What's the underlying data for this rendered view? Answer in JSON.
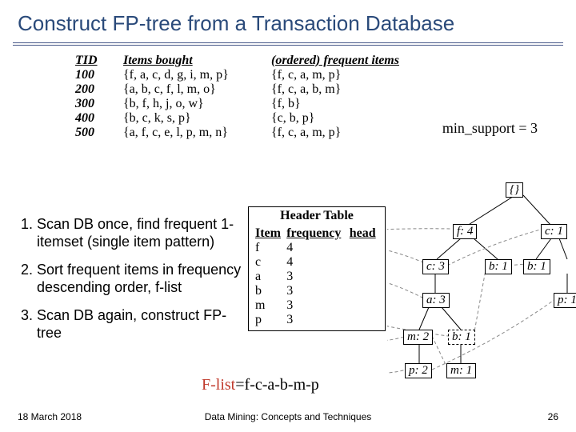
{
  "title": "Construct FP-tree from a Transaction Database",
  "table": {
    "hdr_tid": "TID",
    "hdr_items": "Items bought",
    "hdr_freq": "(ordered) frequent items",
    "rows": [
      {
        "tid": "100",
        "items": "{f, a, c, d, g, i, m, p}",
        "freq": "{f, c, a, m, p}"
      },
      {
        "tid": "200",
        "items": "{a, b, c, f, l, m, o}",
        "freq": "{f, c, a, b, m}"
      },
      {
        "tid": "300",
        "items": "{b, f, h, j, o, w}",
        "freq": "{f, b}"
      },
      {
        "tid": "400",
        "items": "{b, c, k, s, p}",
        "freq": "{c, b, p}"
      },
      {
        "tid": "500",
        "items": "{a, f, c, e, l, p, m, n}",
        "freq": "{f, c, a, m, p}"
      }
    ]
  },
  "min_support": "min_support = 3",
  "steps": [
    "Scan DB once, find frequent 1-itemset (single item pattern)",
    "Sort frequent items in frequency descending order, f-list",
    "Scan DB again, construct FP-tree"
  ],
  "header_table": {
    "title": "Header Table",
    "cols": {
      "item": "Item",
      "freq": "frequency",
      "head": "head"
    },
    "rows": [
      {
        "item": "f",
        "freq": "4"
      },
      {
        "item": "c",
        "freq": "4"
      },
      {
        "item": "a",
        "freq": "3"
      },
      {
        "item": "b",
        "freq": "3"
      },
      {
        "item": "m",
        "freq": "3"
      },
      {
        "item": "p",
        "freq": "3"
      }
    ]
  },
  "flist": {
    "label": "F-list",
    "eq": "=f-c-a-b-m-p"
  },
  "tree": {
    "root": "{}",
    "f4": "f: 4",
    "c1": "c: 1",
    "c3": "c: 3",
    "b1a": "b: 1",
    "b1b": "b: 1",
    "a3": "a: 3",
    "p1": "p: 1",
    "m2": "m: 2",
    "b1c": "b: 1",
    "p2": "p: 2",
    "m1": "m: 1"
  },
  "footer": {
    "date": "18 March 2018",
    "center": "Data Mining: Concepts and Techniques",
    "page": "26"
  }
}
